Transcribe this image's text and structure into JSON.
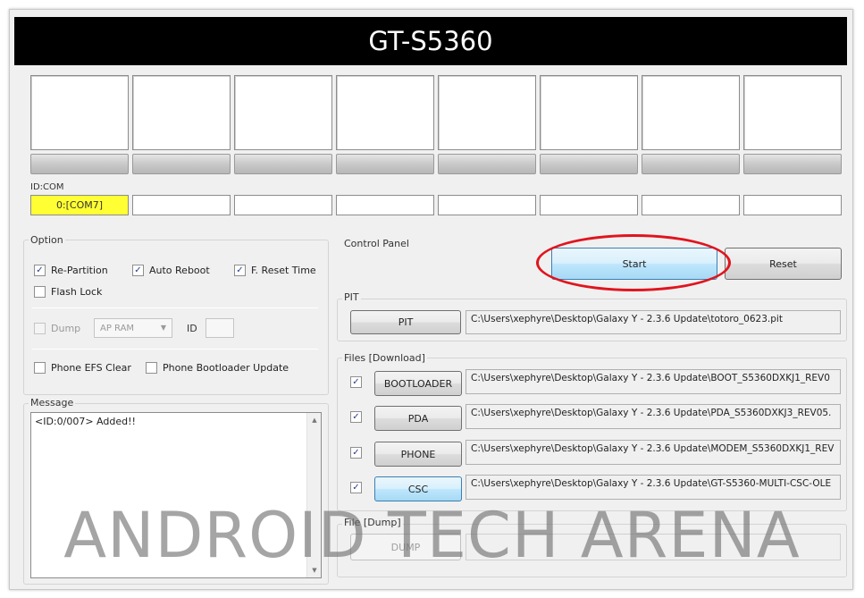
{
  "window": {
    "title": "GT-S5360"
  },
  "ports": {
    "id_com_label": "ID:COM",
    "active_com": "0:[COM7]",
    "count": 8
  },
  "option": {
    "title": "Option",
    "re_partition": {
      "label": "Re-Partition",
      "checked": true
    },
    "auto_reboot": {
      "label": "Auto Reboot",
      "checked": true
    },
    "f_reset_time": {
      "label": "F. Reset Time",
      "checked": true
    },
    "flash_lock": {
      "label": "Flash Lock",
      "checked": false
    },
    "dump": {
      "label": "Dump",
      "checked": false,
      "enabled": false
    },
    "dump_target": {
      "value": "AP RAM"
    },
    "id_label": "ID",
    "phone_efs_clear": {
      "label": "Phone EFS Clear",
      "checked": false
    },
    "phone_bootloader_update": {
      "label": "Phone Bootloader Update",
      "checked": false
    }
  },
  "message": {
    "title": "Message",
    "log": "<ID:0/007> Added!!"
  },
  "control_panel": {
    "title": "Control Panel",
    "start_label": "Start",
    "reset_label": "Reset"
  },
  "pit": {
    "title": "PIT",
    "button_label": "PIT",
    "path": "C:\\Users\\xephyre\\Desktop\\Galaxy Y - 2.3.6 Update\\totoro_0623.pit"
  },
  "files_download": {
    "title": "Files [Download]",
    "rows": [
      {
        "button_label": "BOOTLOADER",
        "checked": true,
        "path": "C:\\Users\\xephyre\\Desktop\\Galaxy Y - 2.3.6 Update\\BOOT_S5360DXKJ1_REV0"
      },
      {
        "button_label": "PDA",
        "checked": true,
        "path": "C:\\Users\\xephyre\\Desktop\\Galaxy Y - 2.3.6 Update\\PDA_S5360DXKJ3_REV05."
      },
      {
        "button_label": "PHONE",
        "checked": true,
        "path": "C:\\Users\\xephyre\\Desktop\\Galaxy Y - 2.3.6 Update\\MODEM_S5360DXKJ1_REV"
      },
      {
        "button_label": "CSC",
        "checked": true,
        "path": "C:\\Users\\xephyre\\Desktop\\Galaxy Y - 2.3.6 Update\\GT-S5360-MULTI-CSC-OLE"
      }
    ]
  },
  "file_dump": {
    "title": "File [Dump]",
    "button_label": "DUMP",
    "path": ""
  },
  "watermark": "ANDROID TECH ARENA",
  "colors": {
    "active_com": "#ffff33",
    "highlight_ellipse": "#e0141e",
    "title_bar": "#000000"
  }
}
